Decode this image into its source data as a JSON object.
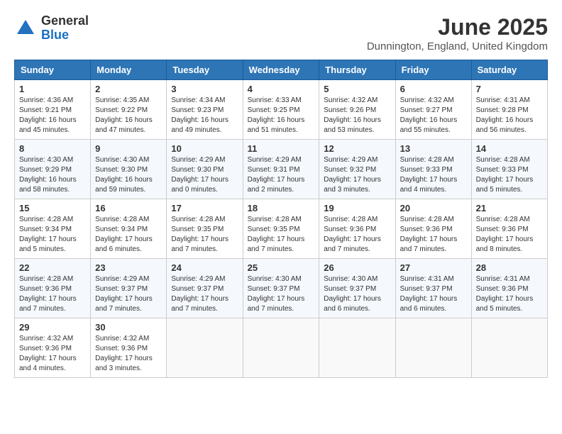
{
  "header": {
    "logo_general": "General",
    "logo_blue": "Blue",
    "month_title": "June 2025",
    "location": "Dunnington, England, United Kingdom"
  },
  "days_of_week": [
    "Sunday",
    "Monday",
    "Tuesday",
    "Wednesday",
    "Thursday",
    "Friday",
    "Saturday"
  ],
  "weeks": [
    [
      {
        "day": "1",
        "info": "Sunrise: 4:36 AM\nSunset: 9:21 PM\nDaylight: 16 hours\nand 45 minutes."
      },
      {
        "day": "2",
        "info": "Sunrise: 4:35 AM\nSunset: 9:22 PM\nDaylight: 16 hours\nand 47 minutes."
      },
      {
        "day": "3",
        "info": "Sunrise: 4:34 AM\nSunset: 9:23 PM\nDaylight: 16 hours\nand 49 minutes."
      },
      {
        "day": "4",
        "info": "Sunrise: 4:33 AM\nSunset: 9:25 PM\nDaylight: 16 hours\nand 51 minutes."
      },
      {
        "day": "5",
        "info": "Sunrise: 4:32 AM\nSunset: 9:26 PM\nDaylight: 16 hours\nand 53 minutes."
      },
      {
        "day": "6",
        "info": "Sunrise: 4:32 AM\nSunset: 9:27 PM\nDaylight: 16 hours\nand 55 minutes."
      },
      {
        "day": "7",
        "info": "Sunrise: 4:31 AM\nSunset: 9:28 PM\nDaylight: 16 hours\nand 56 minutes."
      }
    ],
    [
      {
        "day": "8",
        "info": "Sunrise: 4:30 AM\nSunset: 9:29 PM\nDaylight: 16 hours\nand 58 minutes."
      },
      {
        "day": "9",
        "info": "Sunrise: 4:30 AM\nSunset: 9:30 PM\nDaylight: 16 hours\nand 59 minutes."
      },
      {
        "day": "10",
        "info": "Sunrise: 4:29 AM\nSunset: 9:30 PM\nDaylight: 17 hours\nand 0 minutes."
      },
      {
        "day": "11",
        "info": "Sunrise: 4:29 AM\nSunset: 9:31 PM\nDaylight: 17 hours\nand 2 minutes."
      },
      {
        "day": "12",
        "info": "Sunrise: 4:29 AM\nSunset: 9:32 PM\nDaylight: 17 hours\nand 3 minutes."
      },
      {
        "day": "13",
        "info": "Sunrise: 4:28 AM\nSunset: 9:33 PM\nDaylight: 17 hours\nand 4 minutes."
      },
      {
        "day": "14",
        "info": "Sunrise: 4:28 AM\nSunset: 9:33 PM\nDaylight: 17 hours\nand 5 minutes."
      }
    ],
    [
      {
        "day": "15",
        "info": "Sunrise: 4:28 AM\nSunset: 9:34 PM\nDaylight: 17 hours\nand 5 minutes."
      },
      {
        "day": "16",
        "info": "Sunrise: 4:28 AM\nSunset: 9:34 PM\nDaylight: 17 hours\nand 6 minutes."
      },
      {
        "day": "17",
        "info": "Sunrise: 4:28 AM\nSunset: 9:35 PM\nDaylight: 17 hours\nand 7 minutes."
      },
      {
        "day": "18",
        "info": "Sunrise: 4:28 AM\nSunset: 9:35 PM\nDaylight: 17 hours\nand 7 minutes."
      },
      {
        "day": "19",
        "info": "Sunrise: 4:28 AM\nSunset: 9:36 PM\nDaylight: 17 hours\nand 7 minutes."
      },
      {
        "day": "20",
        "info": "Sunrise: 4:28 AM\nSunset: 9:36 PM\nDaylight: 17 hours\nand 7 minutes."
      },
      {
        "day": "21",
        "info": "Sunrise: 4:28 AM\nSunset: 9:36 PM\nDaylight: 17 hours\nand 8 minutes."
      }
    ],
    [
      {
        "day": "22",
        "info": "Sunrise: 4:28 AM\nSunset: 9:36 PM\nDaylight: 17 hours\nand 7 minutes."
      },
      {
        "day": "23",
        "info": "Sunrise: 4:29 AM\nSunset: 9:37 PM\nDaylight: 17 hours\nand 7 minutes."
      },
      {
        "day": "24",
        "info": "Sunrise: 4:29 AM\nSunset: 9:37 PM\nDaylight: 17 hours\nand 7 minutes."
      },
      {
        "day": "25",
        "info": "Sunrise: 4:30 AM\nSunset: 9:37 PM\nDaylight: 17 hours\nand 7 minutes."
      },
      {
        "day": "26",
        "info": "Sunrise: 4:30 AM\nSunset: 9:37 PM\nDaylight: 17 hours\nand 6 minutes."
      },
      {
        "day": "27",
        "info": "Sunrise: 4:31 AM\nSunset: 9:37 PM\nDaylight: 17 hours\nand 6 minutes."
      },
      {
        "day": "28",
        "info": "Sunrise: 4:31 AM\nSunset: 9:36 PM\nDaylight: 17 hours\nand 5 minutes."
      }
    ],
    [
      {
        "day": "29",
        "info": "Sunrise: 4:32 AM\nSunset: 9:36 PM\nDaylight: 17 hours\nand 4 minutes."
      },
      {
        "day": "30",
        "info": "Sunrise: 4:32 AM\nSunset: 9:36 PM\nDaylight: 17 hours\nand 3 minutes."
      },
      {
        "day": "",
        "info": ""
      },
      {
        "day": "",
        "info": ""
      },
      {
        "day": "",
        "info": ""
      },
      {
        "day": "",
        "info": ""
      },
      {
        "day": "",
        "info": ""
      }
    ]
  ]
}
